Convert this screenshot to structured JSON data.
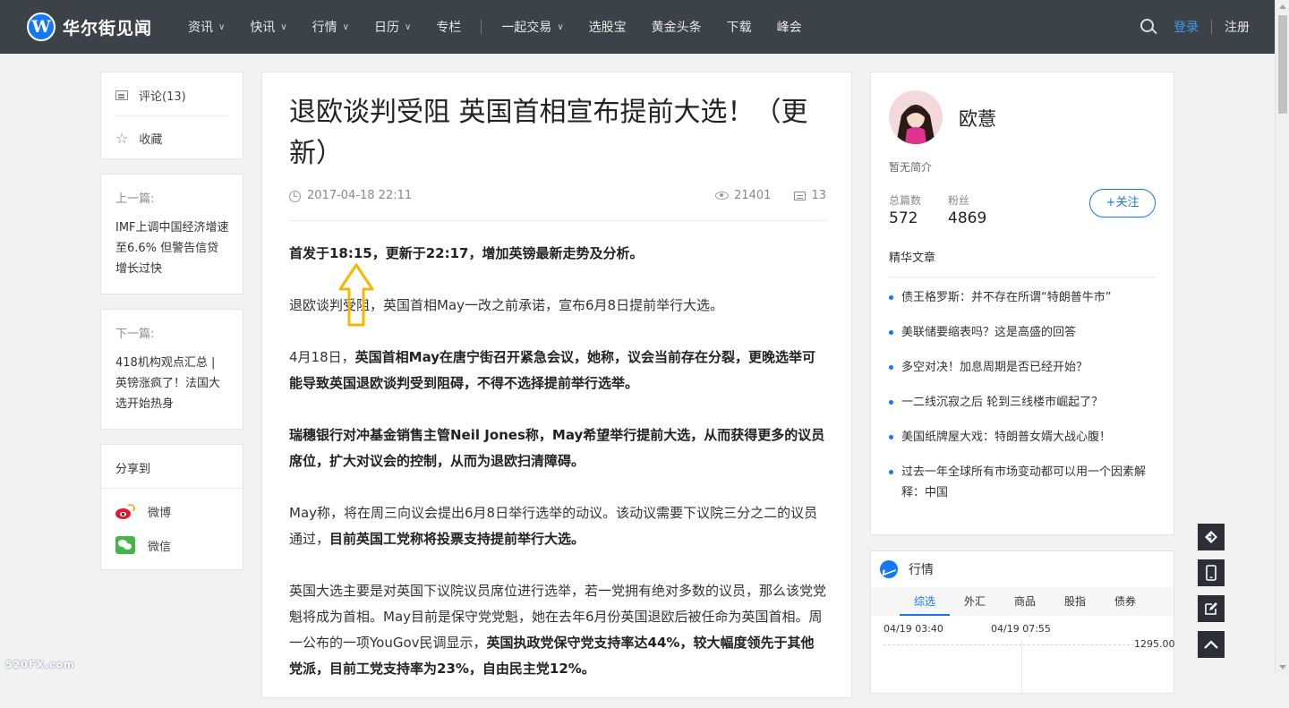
{
  "brand": {
    "logo_letter": "W",
    "name": "华尔街见闻"
  },
  "nav": {
    "items": [
      {
        "label": "资讯",
        "dropdown": true
      },
      {
        "label": "快讯",
        "dropdown": true
      },
      {
        "label": "行情",
        "dropdown": true
      },
      {
        "label": "日历",
        "dropdown": true
      },
      {
        "label": "专栏",
        "dropdown": false
      },
      {
        "label": "一起交易",
        "dropdown": true
      },
      {
        "label": "选股宝",
        "dropdown": false
      },
      {
        "label": "黄金头条",
        "dropdown": false
      },
      {
        "label": "下载",
        "dropdown": false
      },
      {
        "label": "峰会",
        "dropdown": false
      }
    ],
    "login": "登录",
    "register": "注册"
  },
  "sidebar": {
    "comments": "评论(13)",
    "favorite": "收藏",
    "prev_label": "上一篇:",
    "prev_title": "IMF上调中国经济增速至6.6% 但警告信贷增长过快",
    "next_label": "下一篇:",
    "next_title": "418机构观点汇总 | 英镑涨疯了！法国大选开始热身",
    "share_label": "分享到",
    "share_weibo": "微博",
    "share_wechat": "微信"
  },
  "article": {
    "title": "退欧谈判受阻 英国首相宣布提前大选！（更新）",
    "date": "2017-04-18 22:11",
    "views": "21401",
    "comments": "13",
    "p1_bold": "首发于18:15，更新于22:17，增加英镑最新走势及分析。",
    "p2": "退欧谈判受阻，英国首相May一改之前承诺，宣布6月8日提前举行大选。",
    "p3_lead": "4月18日，",
    "p3_bold": "英国首相May在唐宁街召开紧急会议，她称，议会当前存在分裂，更晚选举可能导致英国退欧谈判受到阻碍，不得不选择提前举行选举。",
    "p4_bold": "瑞穗银行对冲基金销售主管Neil Jones称，May希望举行提前大选，从而获得更多的议员席位，扩大对议会的控制，从而为退欧扫清障碍。",
    "p5_lead": "May称，将在周三向议会提出6月8日举行选举的动议。该动议需要下议院三分之二的议员通过，",
    "p5_bold": "目前英国工党称将投票支持提前举行大选。",
    "p6_lead": "英国大选主要是对英国下议院议员席位进行选举，若一党拥有绝对多数的议员，那么该党党魁将成为首相。May目前是保守党党魁，她在去年6月份英国退欧后被任命为英国首相。周一公布的一项YouGov民调显示，",
    "p6_bold": "英国执政党保守党支持率达44%，较大幅度领先于其他党派，目前工党支持率为23%，自由民主党12%。"
  },
  "author": {
    "name": "欧薏",
    "bio": "暂无简介",
    "total_label": "总篇数",
    "total": "572",
    "fans_label": "粉丝",
    "fans": "4869",
    "follow": "+关注",
    "featured_label": "精华文章",
    "featured": [
      "债王格罗斯：并不存在所谓“特朗普牛市”",
      "美联储要缩表吗？这是高盛的回答",
      "多空对决！加息周期是否已经开始？",
      "一二线沉寂之后 轮到三线楼市崛起了？",
      "美国纸牌屋大戏：特朗普女婿大战心腹！",
      "过去一年全球所有市场变动都可以用一个因素解释：中国"
    ]
  },
  "market": {
    "title": "行情",
    "tabs": [
      "综选",
      "外汇",
      "商品",
      "股指",
      "债券"
    ],
    "active_tab": "综选",
    "time1": "04/19 03:40",
    "time2": "04/19 07:55",
    "price": "1295.00"
  },
  "watermark": "520FX.com",
  "colors": {
    "nav_bg": "#3d4249",
    "accent": "#1478f0",
    "annotation_arrow": "#f5b800"
  }
}
